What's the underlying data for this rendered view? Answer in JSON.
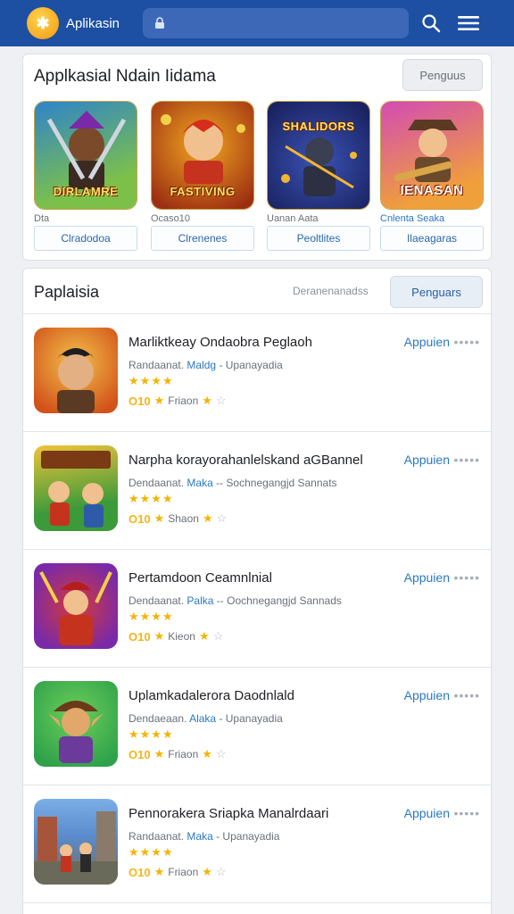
{
  "header": {
    "app_name": "Aplikasin",
    "logo_glyph": "✱",
    "search_value": "",
    "search_icon": "lock-icon",
    "icons": [
      "search-icon",
      "menu-icon"
    ]
  },
  "featured": {
    "title": "Applkasial Ndain Iidama",
    "more_label": "Penguus",
    "items": [
      {
        "badge": "DIRLAMRE",
        "sub": "Dta",
        "button": "Clradodoa",
        "colors": [
          "#2e84c9",
          "#7cc04a"
        ]
      },
      {
        "badge": "FASTIVING",
        "sub": "Ocaso10",
        "button": "Clrenenes",
        "colors": [
          "#f0a720",
          "#9c2d12"
        ]
      },
      {
        "badge": "SHALIDORS",
        "sub": "Uanan Aata",
        "button": "Peoltlites",
        "colors": [
          "#233585",
          "#f3b533"
        ]
      },
      {
        "badge": "IENASAN",
        "sub": "Cnlenta Seaka",
        "button": "Ilaeagaras",
        "colors": [
          "#d34bb4",
          "#f0a03a"
        ]
      }
    ]
  },
  "list": {
    "title": "Paplaisia",
    "subtitle": "Deranenanadss",
    "button": "Penguars",
    "items": [
      {
        "title": "Marliktkeay Ondaobra Peglaoh",
        "meta_a": "Randaanat.",
        "meta_b": "Maldg",
        "meta_c": "- Upanayadia",
        "stars": "★★★★",
        "score": "O10",
        "downloads": "Friaon",
        "action": "Appuien",
        "more": "•••••",
        "colors": [
          "#d2521a",
          "#f2c14a"
        ]
      },
      {
        "title": "Narpha korayorahanlelskand aGBannel",
        "meta_a": "Dendaanat.",
        "meta_b": "Maka",
        "meta_c": "-- Sochnegangjd Sannats",
        "stars": "★★★★",
        "score": "O10",
        "downloads": "Shaon",
        "action": "Appuien",
        "more": "•••••",
        "colors": [
          "#3c9a3a",
          "#f0c33a"
        ]
      },
      {
        "title": "Pertamdoon Ceamnlnial",
        "meta_a": "Dendaanat.",
        "meta_b": "Palka",
        "meta_c": "-- Oochnegangjd Sannads",
        "stars": "★★★★",
        "score": "O10",
        "downloads": "Kieon",
        "action": "Appuien",
        "more": "•••••",
        "colors": [
          "#7a2aa8",
          "#d43a3a"
        ]
      },
      {
        "title": "Uplamkadalerora Daodnlald",
        "meta_a": "Dendaeaan.",
        "meta_b": "Alaka",
        "meta_c": "- Upanayadia",
        "stars": "★★★★",
        "score": "O10",
        "downloads": "Friaon",
        "action": "Appuien",
        "more": "•••••",
        "colors": [
          "#2fa14a",
          "#6b3a9a"
        ]
      },
      {
        "title": "Pennorakera Sriapka Manalrdaari",
        "meta_a": "Randaanat.",
        "meta_b": "Maka",
        "meta_c": "- Upanayadia",
        "stars": "★★★★",
        "score": "O10",
        "downloads": "Friaon",
        "action": "Appuien",
        "more": "•••••",
        "colors": [
          "#5a8acb",
          "#7a6a52"
        ]
      }
    ]
  },
  "colors": {
    "header_bg": "#1d4fa3",
    "accent": "#2a78c2",
    "star": "#f5b400"
  }
}
